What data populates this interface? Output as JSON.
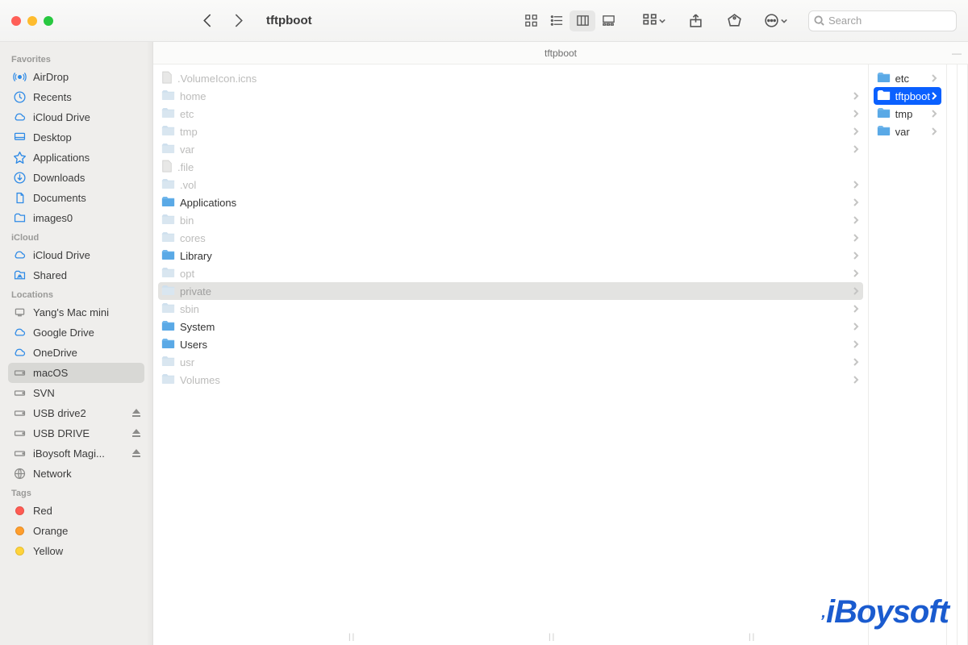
{
  "window": {
    "title": "tftpboot",
    "path_label": "tftpboot"
  },
  "search": {
    "placeholder": "Search"
  },
  "sidebar": {
    "sections": [
      {
        "label": "Favorites",
        "items": [
          {
            "label": "AirDrop",
            "icon": "airdrop"
          },
          {
            "label": "Recents",
            "icon": "clock"
          },
          {
            "label": "iCloud Drive",
            "icon": "cloud"
          },
          {
            "label": "Desktop",
            "icon": "desktop"
          },
          {
            "label": "Applications",
            "icon": "apps"
          },
          {
            "label": "Downloads",
            "icon": "download"
          },
          {
            "label": "Documents",
            "icon": "doc"
          },
          {
            "label": "images0",
            "icon": "folder"
          }
        ]
      },
      {
        "label": "iCloud",
        "items": [
          {
            "label": "iCloud Drive",
            "icon": "cloud"
          },
          {
            "label": "Shared",
            "icon": "sharedfolder"
          }
        ]
      },
      {
        "label": "Locations",
        "items": [
          {
            "label": "Yang's Mac mini",
            "icon": "mac"
          },
          {
            "label": "Google Drive",
            "icon": "cloud"
          },
          {
            "label": "OneDrive",
            "icon": "cloud"
          },
          {
            "label": "macOS",
            "icon": "disk",
            "selected": true
          },
          {
            "label": "SVN",
            "icon": "disk"
          },
          {
            "label": "USB drive2",
            "icon": "disk",
            "eject": true
          },
          {
            "label": "USB DRIVE",
            "icon": "disk",
            "eject": true
          },
          {
            "label": "iBoysoft Magi...",
            "icon": "disk",
            "eject": true
          },
          {
            "label": "Network",
            "icon": "network"
          }
        ]
      },
      {
        "label": "Tags",
        "items": [
          {
            "label": "Red",
            "icon": "tag",
            "color": "#ff5b52"
          },
          {
            "label": "Orange",
            "icon": "tag",
            "color": "#ff9e2c"
          },
          {
            "label": "Yellow",
            "icon": "tag",
            "color": "#ffd33a"
          }
        ]
      }
    ]
  },
  "columns": [
    {
      "items": [
        {
          "label": ".VolumeIcon.icns",
          "type": "file",
          "dim": true,
          "chevron": false
        },
        {
          "label": "home",
          "type": "folder",
          "dim": true,
          "chevron": true
        },
        {
          "label": "etc",
          "type": "folder",
          "dim": true,
          "chevron": true
        },
        {
          "label": "tmp",
          "type": "folder",
          "dim": true,
          "chevron": true
        },
        {
          "label": "var",
          "type": "folder",
          "dim": true,
          "chevron": true
        },
        {
          "label": ".file",
          "type": "file",
          "dim": true,
          "chevron": false
        },
        {
          "label": ".vol",
          "type": "folder",
          "dim": true,
          "chevron": true
        },
        {
          "label": "Applications",
          "type": "folder",
          "chevron": true
        },
        {
          "label": "bin",
          "type": "folder",
          "dim": true,
          "chevron": true
        },
        {
          "label": "cores",
          "type": "folder",
          "dim": true,
          "chevron": true
        },
        {
          "label": "Library",
          "type": "folder",
          "chevron": true
        },
        {
          "label": "opt",
          "type": "folder",
          "dim": true,
          "chevron": true
        },
        {
          "label": "private",
          "type": "folder",
          "dim": true,
          "chevron": true,
          "active": true
        },
        {
          "label": "sbin",
          "type": "folder",
          "dim": true,
          "chevron": true
        },
        {
          "label": "System",
          "type": "folder",
          "chevron": true
        },
        {
          "label": "Users",
          "type": "folder",
          "chevron": true
        },
        {
          "label": "usr",
          "type": "folder",
          "dim": true,
          "chevron": true
        },
        {
          "label": "Volumes",
          "type": "folder",
          "dim": true,
          "chevron": true
        }
      ]
    },
    {
      "items": [
        {
          "label": "etc",
          "type": "folder",
          "chevron": true
        },
        {
          "label": "tftpboot",
          "type": "folder",
          "chevron": true,
          "selected": true
        },
        {
          "label": "tmp",
          "type": "folder",
          "chevron": true
        },
        {
          "label": "var",
          "type": "folder",
          "chevron": true
        }
      ]
    },
    {
      "items": []
    },
    {
      "items": []
    }
  ],
  "watermark": "iBoysoft"
}
